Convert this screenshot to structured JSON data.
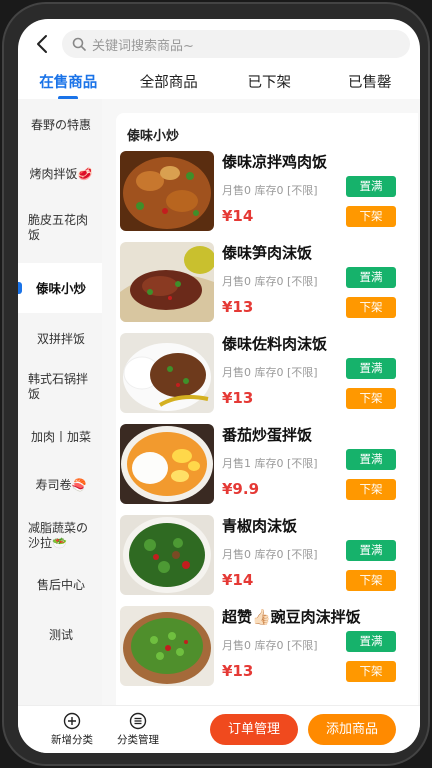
{
  "search": {
    "placeholder": "关键词搜索商品~"
  },
  "tabs": [
    {
      "label": "在售商品",
      "active": true
    },
    {
      "label": "全部商品"
    },
    {
      "label": "已下架"
    },
    {
      "label": "已售罄"
    }
  ],
  "categories": [
    {
      "label": "春野の特惠"
    },
    {
      "label": "烤肉拌饭🥩"
    },
    {
      "label": "脆皮五花肉饭"
    },
    {
      "label": "傣味小炒",
      "active": true
    },
    {
      "label": "双拼拌饭"
    },
    {
      "label": "韩式石锅拌饭"
    },
    {
      "label": "加肉丨加菜"
    },
    {
      "label": "寿司卷🍣"
    },
    {
      "label": "减脂蔬菜の沙拉🥗"
    },
    {
      "label": "售后中心"
    },
    {
      "label": "测试"
    }
  ],
  "section": {
    "title": "傣味小炒"
  },
  "products": [
    {
      "name": "傣味凉拌鸡肉饭",
      "meta": "月售0 库存0 [不限]",
      "price": "¥14",
      "full_label": "置满",
      "off_label": "下架"
    },
    {
      "name": "傣味笋肉沫饭",
      "meta": "月售0 库存0 [不限]",
      "price": "¥13",
      "full_label": "置满",
      "off_label": "下架"
    },
    {
      "name": "傣味佐料肉沫饭",
      "meta": "月售0 库存0 [不限]",
      "price": "¥13",
      "full_label": "置满",
      "off_label": "下架"
    },
    {
      "name": "番茄炒蛋拌饭",
      "meta": "月售1 库存0 [不限]",
      "price": "¥9.9",
      "full_label": "置满",
      "off_label": "下架"
    },
    {
      "name": "青椒肉沫饭",
      "meta": "月售0 库存0 [不限]",
      "price": "¥14",
      "full_label": "置满",
      "off_label": "下架"
    },
    {
      "name": "超赞👍🏻豌豆肉沫拌饭",
      "meta": "月售0 库存0 [不限]",
      "price": "¥13",
      "full_label": "置满",
      "off_label": "下架"
    }
  ],
  "bottom": {
    "add_category": "新增分类",
    "manage_category": "分类管理",
    "order_manage": "订单管理",
    "add_product": "添加商品"
  },
  "colors": {
    "accent": "#1a73e8",
    "price": "#e53935",
    "full_button": "#16b26b",
    "off_button": "#ff9800",
    "order_button": "#f04a1e",
    "add_button": "#ff8a00"
  }
}
